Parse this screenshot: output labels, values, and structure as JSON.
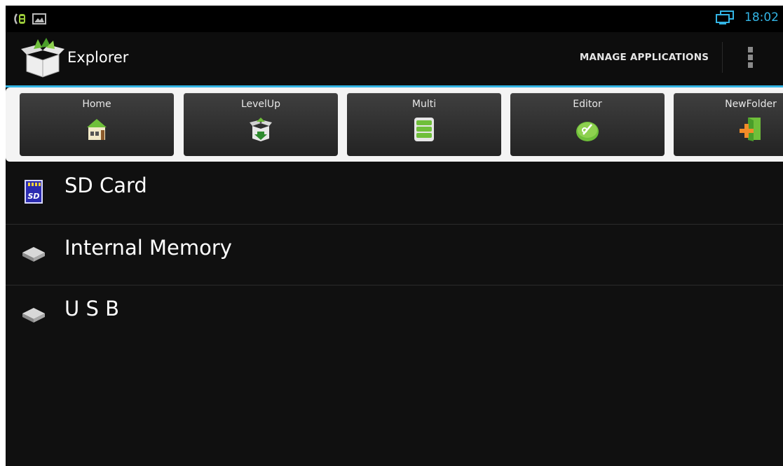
{
  "status_bar": {
    "time": "18:02",
    "left_icons": [
      "usb-debug-icon",
      "image-notification-icon"
    ],
    "right_icons": [
      "network-connected-icon"
    ]
  },
  "action_bar": {
    "title": "Explorer",
    "app_icon": "explorer-box-icon",
    "manage_label": "MANAGE APPLICATIONS",
    "overflow_icon": "overflow-menu-icon",
    "accent_color": "#33b5e5"
  },
  "toolbar": {
    "buttons": [
      {
        "label": "Home",
        "icon": "home-icon"
      },
      {
        "label": "LevelUp",
        "icon": "level-up-icon"
      },
      {
        "label": "Multi",
        "icon": "multi-select-icon"
      },
      {
        "label": "Editor",
        "icon": "editor-icon"
      },
      {
        "label": "NewFolder",
        "icon": "new-folder-icon"
      }
    ]
  },
  "storage_list": {
    "items": [
      {
        "label": "SD Card",
        "icon": "sd-card-icon"
      },
      {
        "label": "Internal Memory",
        "icon": "internal-memory-drive-icon"
      },
      {
        "label": "U S B",
        "icon": "usb-drive-icon"
      }
    ]
  }
}
